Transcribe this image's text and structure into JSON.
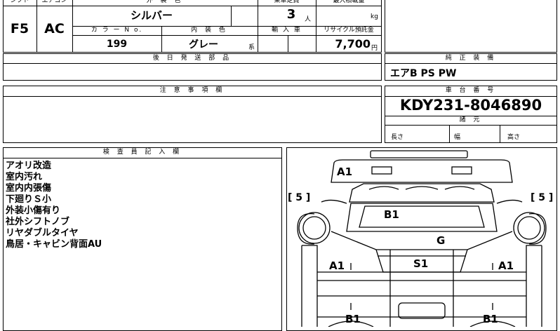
{
  "spec": {
    "shift_header": "シフト",
    "aircon_header": "エアコン",
    "exterior_color_header": "外 装 色",
    "capacity_header": "乗車定員",
    "max_load_header": "最大積載量",
    "shift": "F5",
    "aircon": "AC",
    "exterior_color": "シルバー",
    "capacity": "3",
    "capacity_unit": "人",
    "max_load_unit": "kg",
    "color_no_header": "カ ラ ー N o.",
    "interior_color_header": "内 装 色",
    "import_header": "輸 入 車",
    "recycle_header": "リサイクル預託金",
    "color_no": "199",
    "interior_color": "グレー",
    "interior_suffix": "系",
    "recycle_fee": "7,700",
    "recycle_unit": "円"
  },
  "later_parts": {
    "header": "後 日 発 送 部 品"
  },
  "genuine_equipment": {
    "header": "純 正 装 備",
    "value": "エアB PS PW"
  },
  "notes": {
    "header": "注 意 事 項 欄"
  },
  "chassis": {
    "header": "車 台 番 号",
    "number": "KDY231-8046890",
    "dims_header": "諸 元",
    "length_label": "長さ",
    "width_label": "幅",
    "height_label": "高さ"
  },
  "inspector": {
    "header": "検 査 員 記 入 欄",
    "lines": [
      "アオリ改造",
      "室内汚れ",
      "室内内張傷",
      "下廻りＳ小",
      "外装小傷有り",
      "社外シフトノブ",
      "リヤダブルタイヤ",
      "鳥居・キャビン背面AU"
    ]
  },
  "diagram": {
    "tire_left": "[ 5 ]",
    "tire_right": "[ 5 ]",
    "marks": [
      "A1",
      "B1",
      "G",
      "A1",
      "S1",
      "A1",
      "B1",
      "B1"
    ]
  }
}
